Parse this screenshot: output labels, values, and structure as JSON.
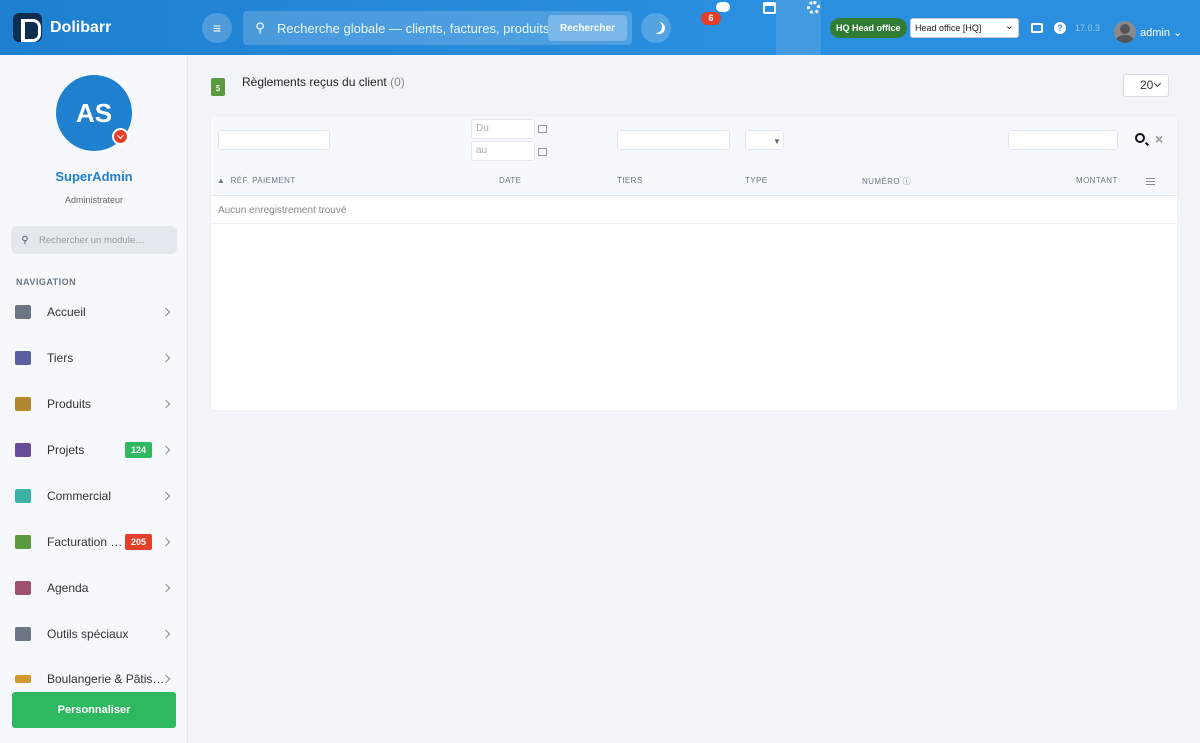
{
  "header": {
    "app_name": "Dolibarr",
    "search_placeholder": "Recherche globale — clients, factures, produits…",
    "search_button": "Rechercher",
    "chat_badge": "6",
    "hq_badge": "HQ Head office",
    "entity_select": "Head office [HQ]",
    "version": "17.0.3",
    "user": "admin"
  },
  "sidebar": {
    "initials": "AS",
    "user_fullname": "SuperAdmin",
    "user_role": "Administrateur",
    "module_search_placeholder": "Rechercher un module…",
    "nav_title": "NAVIGATION",
    "items": [
      {
        "label": "Accueil",
        "icon": "home-icon",
        "color": "#6b7785"
      },
      {
        "label": "Tiers",
        "icon": "building-icon",
        "color": "#5a5fa0"
      },
      {
        "label": "Produits",
        "icon": "box-icon",
        "color": "#b0892e"
      },
      {
        "label": "Projets",
        "icon": "sitemap-icon",
        "color": "#6a4c9c",
        "badge": "124",
        "badge_color": "#2eb860"
      },
      {
        "label": "Commercial",
        "icon": "suitcase-icon",
        "color": "#3cb3a8"
      },
      {
        "label": "Facturation …",
        "icon": "invoice-icon",
        "color": "#5a9a3c",
        "badge": "205",
        "badge_color": "#e43f2b"
      },
      {
        "label": "Agenda",
        "icon": "calendar-icon",
        "color": "#a05070"
      },
      {
        "label": "Outils spéciaux",
        "icon": "tools-icon",
        "color": "#6b7785"
      },
      {
        "label": "Boulangerie & Pâtis…",
        "icon": "bakery-icon",
        "color": "#d09a30"
      }
    ],
    "personalize_button": "Personnaliser"
  },
  "main": {
    "title": "Règlements reçus du client",
    "count": "(0)",
    "limit": "20",
    "filters": {
      "date_from_placeholder": "Du",
      "date_to_placeholder": "au"
    },
    "columns": [
      "RÉF. PAIEMENT",
      "DATE",
      "TIERS",
      "TYPE",
      "NUMÉRO",
      "MONTANT"
    ],
    "empty_message": "Aucun enregistrement trouvé"
  }
}
